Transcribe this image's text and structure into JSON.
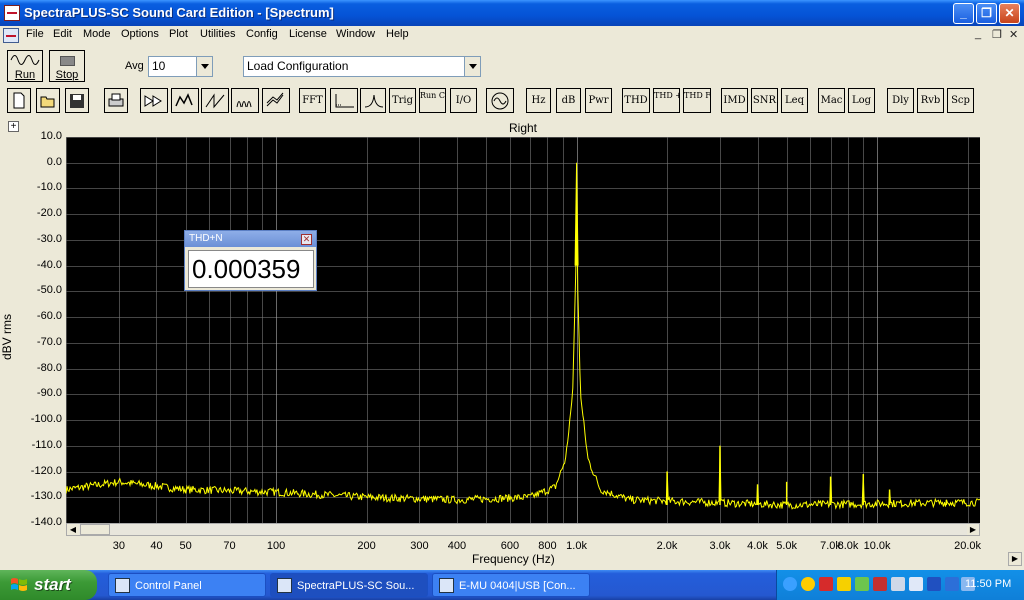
{
  "window": {
    "title": "SpectraPLUS-SC Sound Card Edition - [Spectrum]",
    "controls": [
      "_",
      "❐",
      "✕"
    ]
  },
  "menubar": {
    "items": [
      "File",
      "Edit",
      "Mode",
      "Options",
      "Plot",
      "Utilities",
      "Config",
      "License",
      "Window",
      "Help"
    ],
    "mdi_controls": [
      "_",
      "❐",
      "✕"
    ]
  },
  "toolbar1": {
    "run_label": "Run",
    "stop_label": "Stop",
    "avg_label": "Avg",
    "avg_value": "10",
    "config_value": "Load Configuration"
  },
  "toolbar2": {
    "text_buttons": [
      "FFT",
      "Trig",
      "Run Ctrl",
      "I/O",
      "Hz",
      "dB",
      "Pwr",
      "THD",
      "THD +N",
      "THD Freq",
      "IMD",
      "SNR",
      "Leq",
      "Mac",
      "Log",
      "Dly",
      "Rvb",
      "Scp"
    ],
    "icon_buttons": [
      "new-icon",
      "open-icon",
      "save-icon",
      "print-icon",
      "fast-forward-icon",
      "spectrum-tool-icon",
      "ramp-icon",
      "waterfall-icon",
      "spectrogram-icon",
      "marker-icon",
      "peak-icon",
      "sine-icon"
    ]
  },
  "graph": {
    "title": "Right",
    "ylabel": "dBV rms",
    "xlabel": "Frequency (Hz)",
    "y_ticks": [
      "10.0",
      "0.0",
      "-10.0",
      "-20.0",
      "-30.0",
      "-40.0",
      "-50.0",
      "-60.0",
      "-70.0",
      "-80.0",
      "-90.0",
      "-100.0",
      "-110.0",
      "-120.0",
      "-130.0",
      "-140.0"
    ],
    "x_ticks": [
      "30",
      "40",
      "50",
      "70",
      "100",
      "200",
      "300",
      "400",
      "600",
      "800",
      "1.0k",
      "2.0k",
      "3.0k",
      "4.0k",
      "5.0k",
      "7.0k",
      "8.0k",
      "10.0k",
      "20.0k"
    ]
  },
  "chart_data": {
    "type": "line",
    "title": "Right",
    "xlabel": "Frequency (Hz)",
    "ylabel": "dBV rms",
    "x_scale": "log",
    "xlim": [
      20,
      22000
    ],
    "ylim": [
      -140,
      10
    ],
    "grid": true,
    "line_color": "#ffff00",
    "background": "#000000",
    "noise_floor_points": [
      [
        20,
        -127
      ],
      [
        30,
        -124
      ],
      [
        50,
        -127
      ],
      [
        100,
        -128
      ],
      [
        200,
        -130
      ],
      [
        400,
        -131
      ],
      [
        700,
        -130
      ],
      [
        850,
        -126
      ],
      [
        920,
        -115
      ],
      [
        970,
        -90
      ],
      [
        995,
        -40
      ],
      [
        1000,
        0
      ],
      [
        1005,
        -40
      ],
      [
        1030,
        -90
      ],
      [
        1090,
        -115
      ],
      [
        1200,
        -127
      ],
      [
        1500,
        -131
      ],
      [
        5000,
        -133
      ],
      [
        20000,
        -132
      ]
    ],
    "harmonics": [
      [
        2000,
        -120
      ],
      [
        3000,
        -110
      ],
      [
        4000,
        -125
      ],
      [
        5000,
        -124
      ],
      [
        7000,
        -122
      ],
      [
        9000,
        -121
      ],
      [
        11000,
        -127
      ],
      [
        17000,
        -131
      ]
    ]
  },
  "thd_popup": {
    "title": "THD+N",
    "value": "0.000359"
  },
  "taskbar": {
    "start_label": "start",
    "tasks": [
      "Control Panel",
      "SpectraPLUS-SC Sou...",
      "E-MU 0404|USB [Con..."
    ],
    "clock": "11:50 PM"
  }
}
